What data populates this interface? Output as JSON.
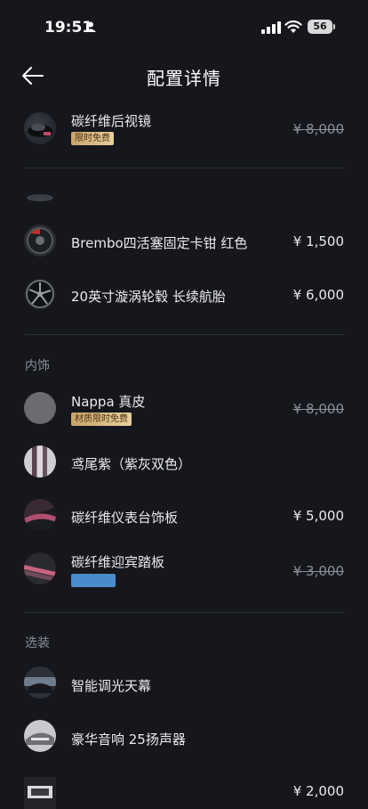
{
  "status": {
    "time": "19:51",
    "battery": "56"
  },
  "nav": {
    "title": "配置详情"
  },
  "items": {
    "mirror": {
      "name": "碳纤维后视镜",
      "badge": "限时免费",
      "price": "¥ 8,000"
    },
    "caliper": {
      "name": "Brembo四活塞固定卡钳 红色",
      "price": "¥ 1,500"
    },
    "wheels": {
      "name": "20英寸漩涡轮毂 长续航胎",
      "price": "¥ 6,000"
    },
    "nappa": {
      "name": "Nappa 真皮",
      "badge": "材质限时免费",
      "price": "¥ 8,000"
    },
    "purple": {
      "name": "鸢尾紫（紫灰双色）"
    },
    "dash": {
      "name": "碳纤维仪表台饰板",
      "price": "¥ 5,000"
    },
    "sill": {
      "name": "碳纤维迎宾踏板",
      "price": "¥ 3,000"
    },
    "roof": {
      "name": "智能调光天幕"
    },
    "audio": {
      "name": "豪华音响 25扬声器"
    },
    "last": {
      "price": "¥ 2,000"
    }
  },
  "sections": {
    "interior": "内饰",
    "options": "选装"
  },
  "colors": {
    "background": "#15171c",
    "badge_gold": "#d8b780",
    "chip_blue": "#4a8cc9"
  },
  "icons": [
    "person-icon",
    "signal-icon",
    "wifi-icon",
    "back-arrow-icon"
  ]
}
